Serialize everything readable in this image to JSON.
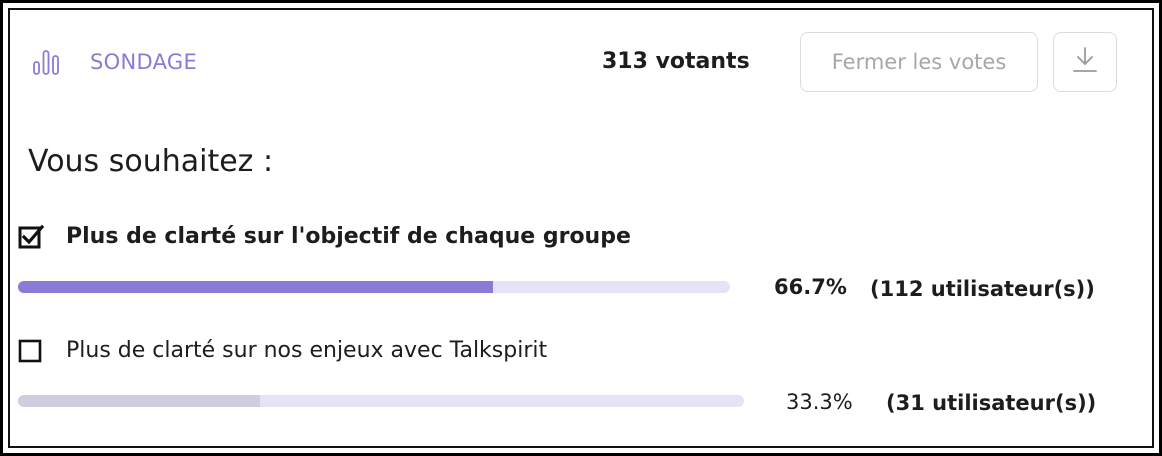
{
  "poll": {
    "label": "SONDAGE",
    "icon": "bar-chart-icon",
    "voters_text": "313 votants",
    "close_label": "Fermer les votes",
    "download_icon": "download-icon",
    "question": "Vous souhaitez :",
    "accent_color": "#8b7ad6",
    "options": [
      {
        "label": "Plus de clarté sur l'objectif de chaque groupe",
        "checked": true,
        "percent_text": "66.7%",
        "count_text": "(112 utilisateur(s))",
        "fraction": 0.667,
        "fill_color": "#8b7ad6",
        "track_color": "#e7e3f6"
      },
      {
        "label": "Plus de clarté sur nos enjeux avec Talkspirit",
        "checked": false,
        "percent_text": "33.3%",
        "count_text": "(31 utilisateur(s))",
        "fraction": 0.333,
        "fill_color": "#cfcde0",
        "track_color": "#e7e3f6"
      }
    ]
  }
}
